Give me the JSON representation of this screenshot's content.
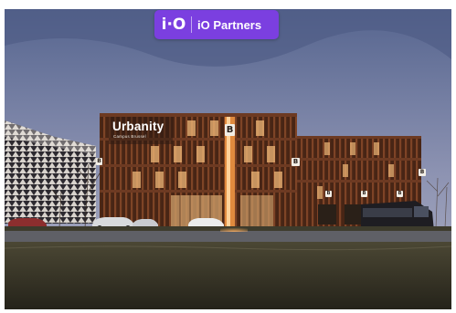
{
  "badge": {
    "logo_text": "i·O",
    "label": "iO Partners",
    "color": "#7b3fe0"
  },
  "building": {
    "sign_title": "Urbanity",
    "sign_subtitle": "Campus Brussel"
  },
  "markers": [
    {
      "id": "marker-main",
      "label": "B"
    },
    {
      "id": "marker-left",
      "label": "B"
    },
    {
      "id": "marker-center",
      "label": "B"
    },
    {
      "id": "marker-annex-1",
      "label": "B"
    },
    {
      "id": "marker-annex-2",
      "label": "B"
    },
    {
      "id": "marker-annex-3",
      "label": "B"
    },
    {
      "id": "marker-right",
      "label": "B"
    }
  ],
  "colors": {
    "sky_top": "#5b6a93",
    "sky_bottom": "#a3a9c4",
    "facade": "#5a2e1c",
    "window_glow": "#f0b878",
    "grass": "#3a3526"
  }
}
